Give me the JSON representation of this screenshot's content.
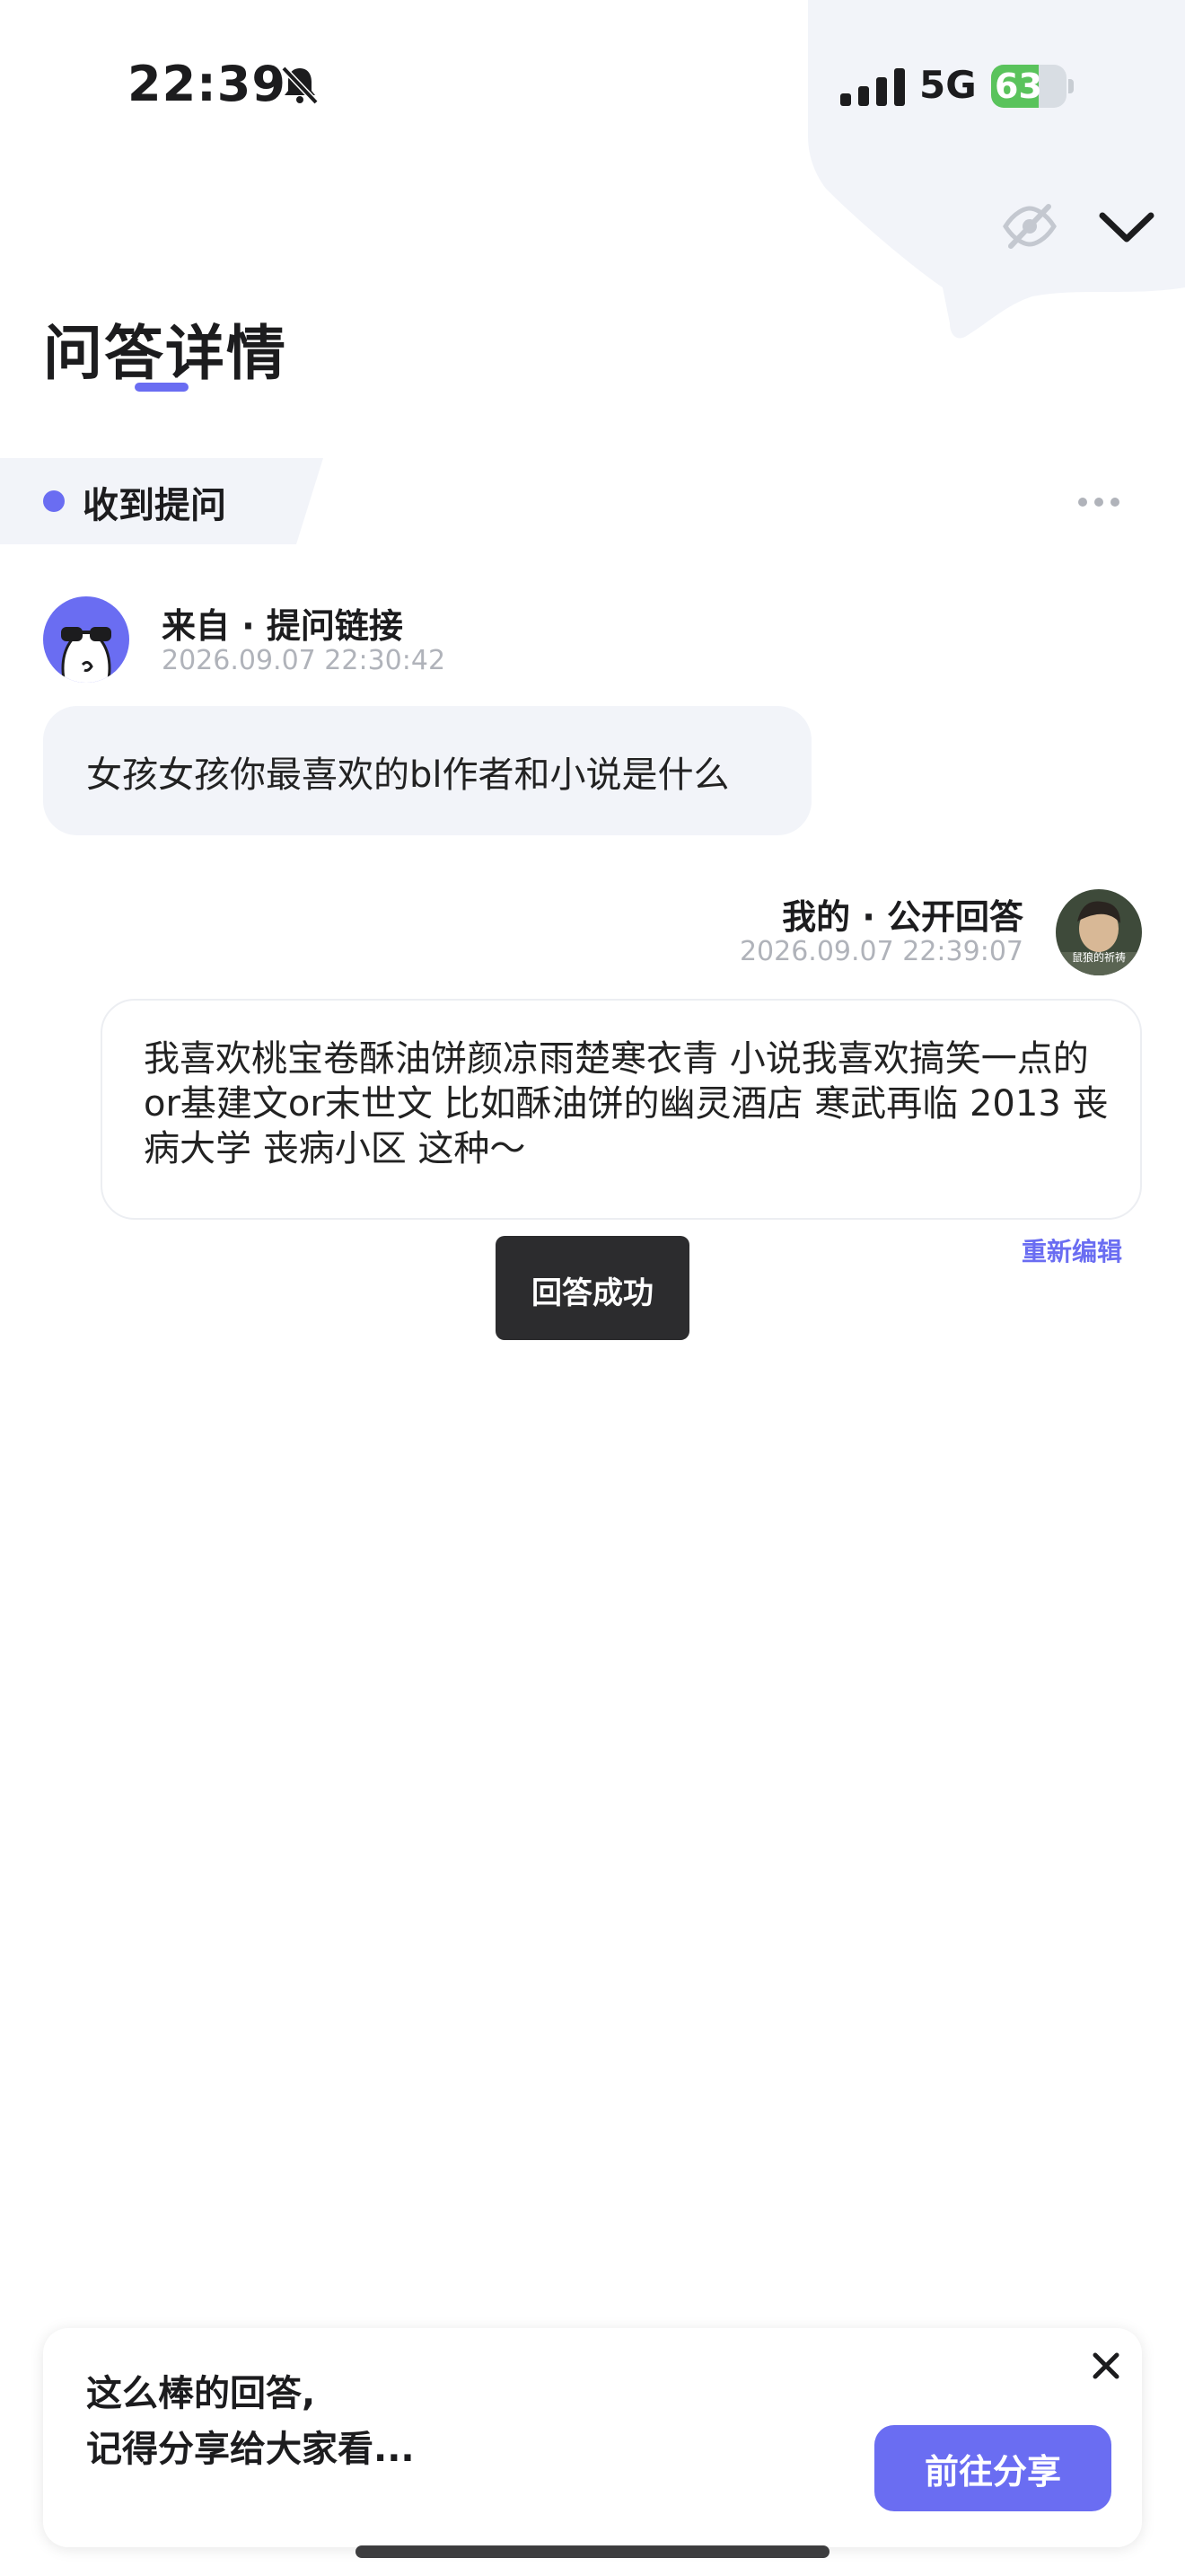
{
  "status_bar": {
    "time": "22:39",
    "network": "5G",
    "battery": "63",
    "battery_level": 0.63
  },
  "colors": {
    "accent": "#6a6df2",
    "battery_green": "#5ac35c",
    "toast_bg": "#2c2c2e"
  },
  "icons": [
    "bell-muted-icon",
    "signal-icon",
    "battery-icon",
    "eye-off-icon",
    "chevron-down-icon",
    "more-dots-icon",
    "close-icon"
  ],
  "header": {
    "title": "问答详情"
  },
  "tab": {
    "label": "收到提问"
  },
  "question": {
    "from": "来自 · 提问链接",
    "time": "2026.09.07 22:30:42",
    "text": "女孩女孩你最喜欢的bl作者和小说是什么"
  },
  "answer": {
    "from": "我的 · 公开回答",
    "time": "2026.09.07 22:39:07",
    "avatar_caption": "鼠狼的祈祷",
    "text": "我喜欢桃宝卷酥油饼颜凉雨楚寒衣青  小说我喜欢搞笑一点的or基建文or末世文 比如酥油饼的幽灵酒店 寒武再临 2013 丧病大学 丧病小区 这种～",
    "reedit": "重新编辑"
  },
  "toast": {
    "text": "回答成功"
  },
  "share": {
    "line1": "这么棒的回答,",
    "line2": "记得分享给大家看...",
    "button": "前往分享"
  }
}
